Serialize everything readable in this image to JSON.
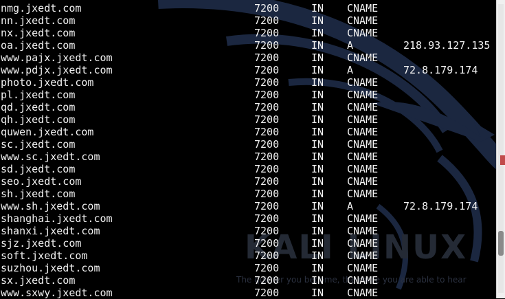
{
  "wallpaper": {
    "brand": "KALI LINUX",
    "tagline": "The quieter you become, the more you are able to hear",
    "colors": {
      "background": "#000000",
      "dragon": "#1b2740",
      "watermark": "#242a35"
    }
  },
  "terminal": {
    "text_color": "#f2f2f2",
    "records": [
      {
        "name": "nmg.jxedt.com",
        "ttl": "7200",
        "class": "IN",
        "type": "CNAME",
        "data": ""
      },
      {
        "name": "nn.jxedt.com",
        "ttl": "7200",
        "class": "IN",
        "type": "CNAME",
        "data": ""
      },
      {
        "name": "nx.jxedt.com",
        "ttl": "7200",
        "class": "IN",
        "type": "CNAME",
        "data": ""
      },
      {
        "name": "oa.jxedt.com",
        "ttl": "7200",
        "class": "IN",
        "type": "A",
        "data": "218.93.127.135"
      },
      {
        "name": "www.pajx.jxedt.com",
        "ttl": "7200",
        "class": "IN",
        "type": "CNAME",
        "data": ""
      },
      {
        "name": "www.pdjx.jxedt.com",
        "ttl": "7200",
        "class": "IN",
        "type": "A",
        "data": "72.8.179.174"
      },
      {
        "name": "photo.jxedt.com",
        "ttl": "7200",
        "class": "IN",
        "type": "CNAME",
        "data": ""
      },
      {
        "name": "pl.jxedt.com",
        "ttl": "7200",
        "class": "IN",
        "type": "CNAME",
        "data": ""
      },
      {
        "name": "qd.jxedt.com",
        "ttl": "7200",
        "class": "IN",
        "type": "CNAME",
        "data": ""
      },
      {
        "name": "qh.jxedt.com",
        "ttl": "7200",
        "class": "IN",
        "type": "CNAME",
        "data": ""
      },
      {
        "name": "quwen.jxedt.com",
        "ttl": "7200",
        "class": "IN",
        "type": "CNAME",
        "data": ""
      },
      {
        "name": "sc.jxedt.com",
        "ttl": "7200",
        "class": "IN",
        "type": "CNAME",
        "data": ""
      },
      {
        "name": "www.sc.jxedt.com",
        "ttl": "7200",
        "class": "IN",
        "type": "CNAME",
        "data": ""
      },
      {
        "name": "sd.jxedt.com",
        "ttl": "7200",
        "class": "IN",
        "type": "CNAME",
        "data": ""
      },
      {
        "name": "seo.jxedt.com",
        "ttl": "7200",
        "class": "IN",
        "type": "CNAME",
        "data": ""
      },
      {
        "name": "sh.jxedt.com",
        "ttl": "7200",
        "class": "IN",
        "type": "CNAME",
        "data": ""
      },
      {
        "name": "www.sh.jxedt.com",
        "ttl": "7200",
        "class": "IN",
        "type": "A",
        "data": "72.8.179.174"
      },
      {
        "name": "shanghai.jxedt.com",
        "ttl": "7200",
        "class": "IN",
        "type": "CNAME",
        "data": ""
      },
      {
        "name": "shanxi.jxedt.com",
        "ttl": "7200",
        "class": "IN",
        "type": "CNAME",
        "data": ""
      },
      {
        "name": "sjz.jxedt.com",
        "ttl": "7200",
        "class": "IN",
        "type": "CNAME",
        "data": ""
      },
      {
        "name": "soft.jxedt.com",
        "ttl": "7200",
        "class": "IN",
        "type": "CNAME",
        "data": ""
      },
      {
        "name": "suzhou.jxedt.com",
        "ttl": "7200",
        "class": "IN",
        "type": "CNAME",
        "data": ""
      },
      {
        "name": "sx.jxedt.com",
        "ttl": "7200",
        "class": "IN",
        "type": "CNAME",
        "data": ""
      },
      {
        "name": "www.sxwy.jxedt.com",
        "ttl": "7200",
        "class": "IN",
        "type": "CNAME",
        "data": ""
      }
    ]
  },
  "scrollbar": {
    "position_fraction": 0.86
  }
}
